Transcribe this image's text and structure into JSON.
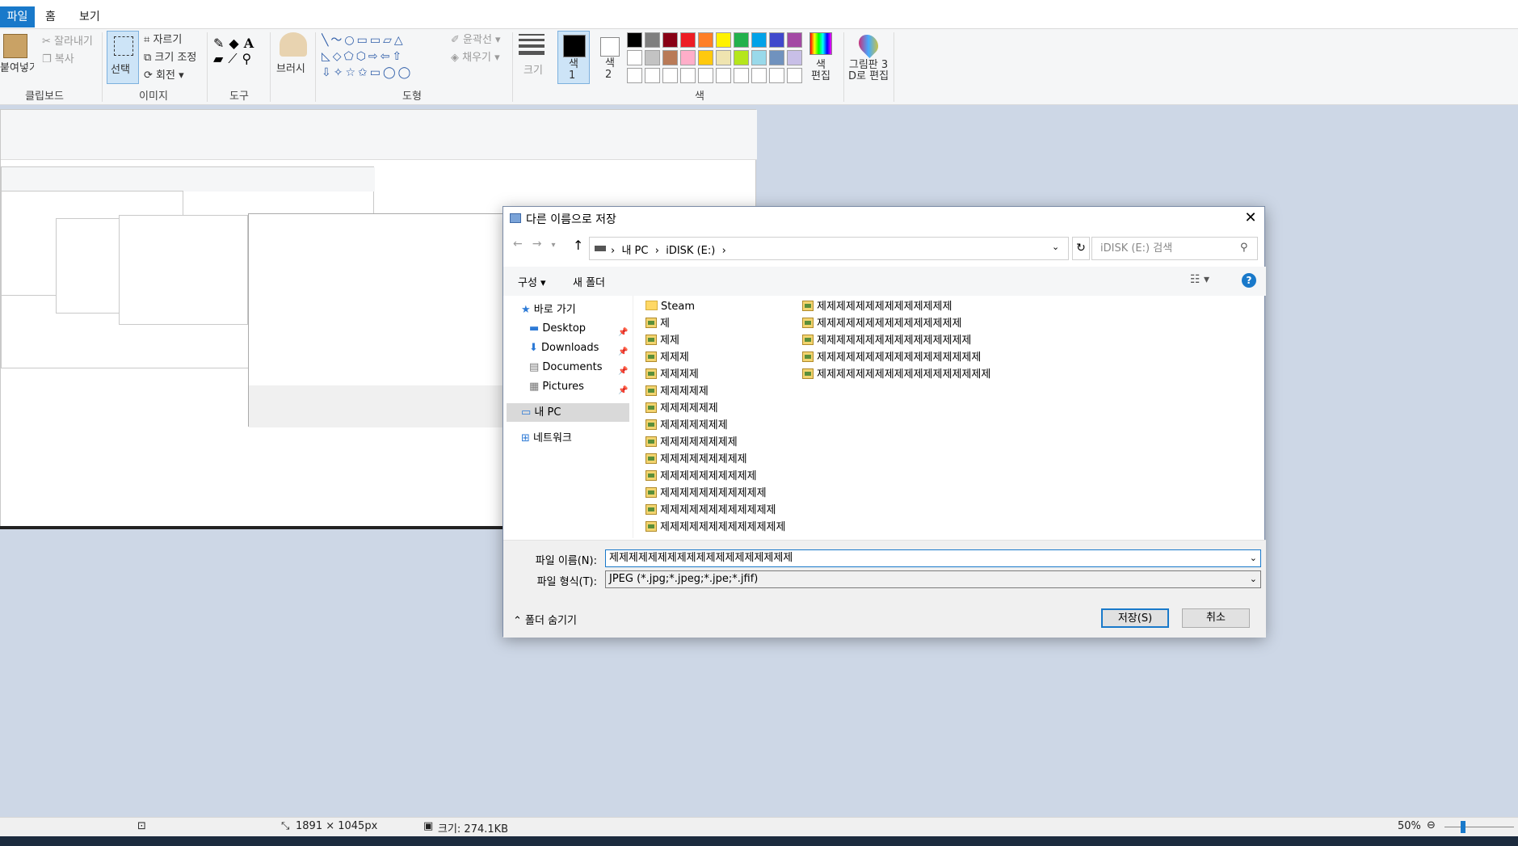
{
  "tabs": {
    "file": "파일",
    "home": "홈",
    "view": "보기"
  },
  "ribbon": {
    "clipboard": {
      "paste": "붙여넣기",
      "cut": "잘라내기",
      "copy": "복사",
      "label": "클립보드"
    },
    "image": {
      "select": "선택",
      "crop": "자르기",
      "resize": "크기 조정",
      "rotate": "회전",
      "label": "이미지"
    },
    "tools": {
      "label": "도구"
    },
    "brushes": {
      "label": "브러시"
    },
    "shapes": {
      "outline": "윤곽선",
      "fill": "채우기",
      "label": "도형"
    },
    "size": {
      "label": "크기"
    },
    "color1": {
      "label": "색\n1"
    },
    "color2": {
      "label": "색\n2"
    },
    "colors": {
      "label": "색",
      "edit": "색\n편집",
      "palette_row1": [
        "#000000",
        "#7f7f7f",
        "#880015",
        "#ed1c24",
        "#ff7f27",
        "#fff200",
        "#22b14c",
        "#00a2e8",
        "#3f48cc",
        "#a349a4"
      ],
      "palette_row2": [
        "#ffffff",
        "#c3c3c3",
        "#b97a57",
        "#ffaec9",
        "#ffc90e",
        "#efe4b0",
        "#b5e61d",
        "#99d9ea",
        "#7092be",
        "#c8bfe7"
      ]
    },
    "paint3d": {
      "label": "그림판 3\nD로 편집"
    }
  },
  "status": {
    "dimensions": "1891 × 1045px",
    "size": "크기: 274.1KB",
    "zoom": "50%"
  },
  "dialog": {
    "title": "다른 이름으로 저장",
    "breadcrumb": [
      "내 PC",
      "iDISK (E:)"
    ],
    "search_placeholder": "iDISK (E:) 검색",
    "organize": "구성",
    "new_folder": "새 폴더",
    "nav": {
      "quick": "바로 가기",
      "desktop": "Desktop",
      "downloads": "Downloads",
      "documents": "Documents",
      "pictures": "Pictures",
      "thispc": "내 PC",
      "network": "네트워크"
    },
    "files_col1": [
      "Steam",
      "제",
      "제제",
      "제제제",
      "제제제제",
      "제제제제제",
      "제제제제제제",
      "제제제제제제제",
      "제제제제제제제제",
      "제제제제제제제제제",
      "제제제제제제제제제제",
      "제제제제제제제제제제제",
      "제제제제제제제제제제제제",
      "제제제제제제제제제제제제제"
    ],
    "files_col2": [
      "제제제제제제제제제제제제제제",
      "제제제제제제제제제제제제제제제",
      "제제제제제제제제제제제제제제제제",
      "제제제제제제제제제제제제제제제제제",
      "제제제제제제제제제제제제제제제제제제"
    ],
    "filename_label": "파일 이름(N):",
    "filename_value": "제제제제제제제제제제제제제제제제제제제",
    "filetype_label": "파일 형식(T):",
    "filetype_value": "JPEG (*.jpg;*.jpeg;*.jpe;*.jfif)",
    "hide_folders": "폴더 숨기기",
    "save": "저장(S)",
    "cancel": "취소"
  }
}
